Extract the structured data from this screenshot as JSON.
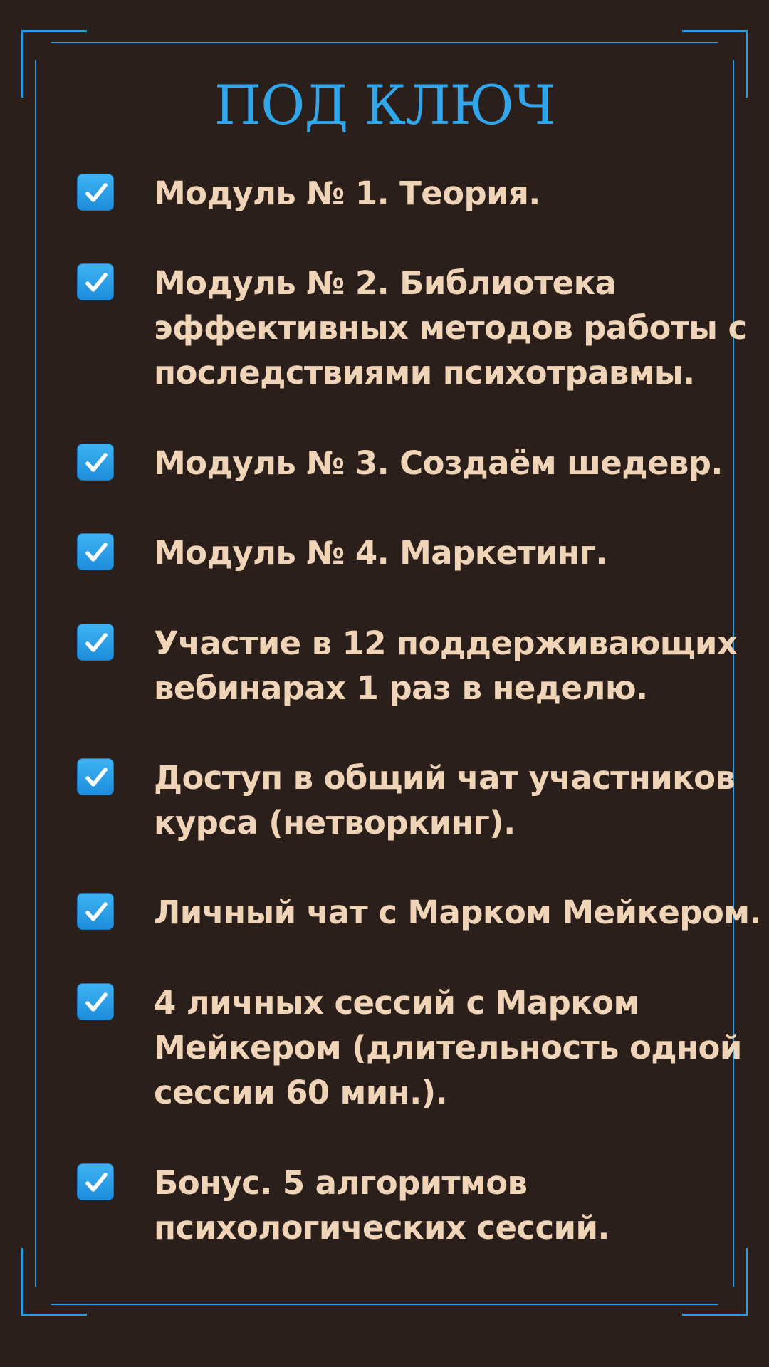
{
  "title": "ПОД КЛЮЧ",
  "colors": {
    "background": "#2b1f1b",
    "accent": "#2b9be0",
    "text": "#f0d4b8"
  },
  "check_icon": "check-box-icon",
  "items": [
    {
      "lines": [
        "Модуль № 1. Теория."
      ]
    },
    {
      "lines": [
        "Модуль № 2. Библиотека",
        "эффективных методов работы с",
        "последствиями психотравмы."
      ]
    },
    {
      "lines": [
        "Модуль № 3. Создаём шедевр."
      ]
    },
    {
      "lines": [
        "Модуль № 4. Маркетинг."
      ]
    },
    {
      "lines": [
        "Участие в 12 поддерживающих",
        "вебинарах 1 раз в неделю."
      ]
    },
    {
      "lines": [
        "Доступ в общий чат участников",
        "курса (нетворкинг)."
      ]
    },
    {
      "lines": [
        "Личный чат с Марком Мейкером."
      ]
    },
    {
      "lines": [
        "4 личных сессий с Марком",
        "Мейкером (длительность одной",
        "сессии 60 мин.)."
      ]
    },
    {
      "lines": [
        "Бонус. 5 алгоритмов",
        "психологических сессий."
      ]
    }
  ]
}
